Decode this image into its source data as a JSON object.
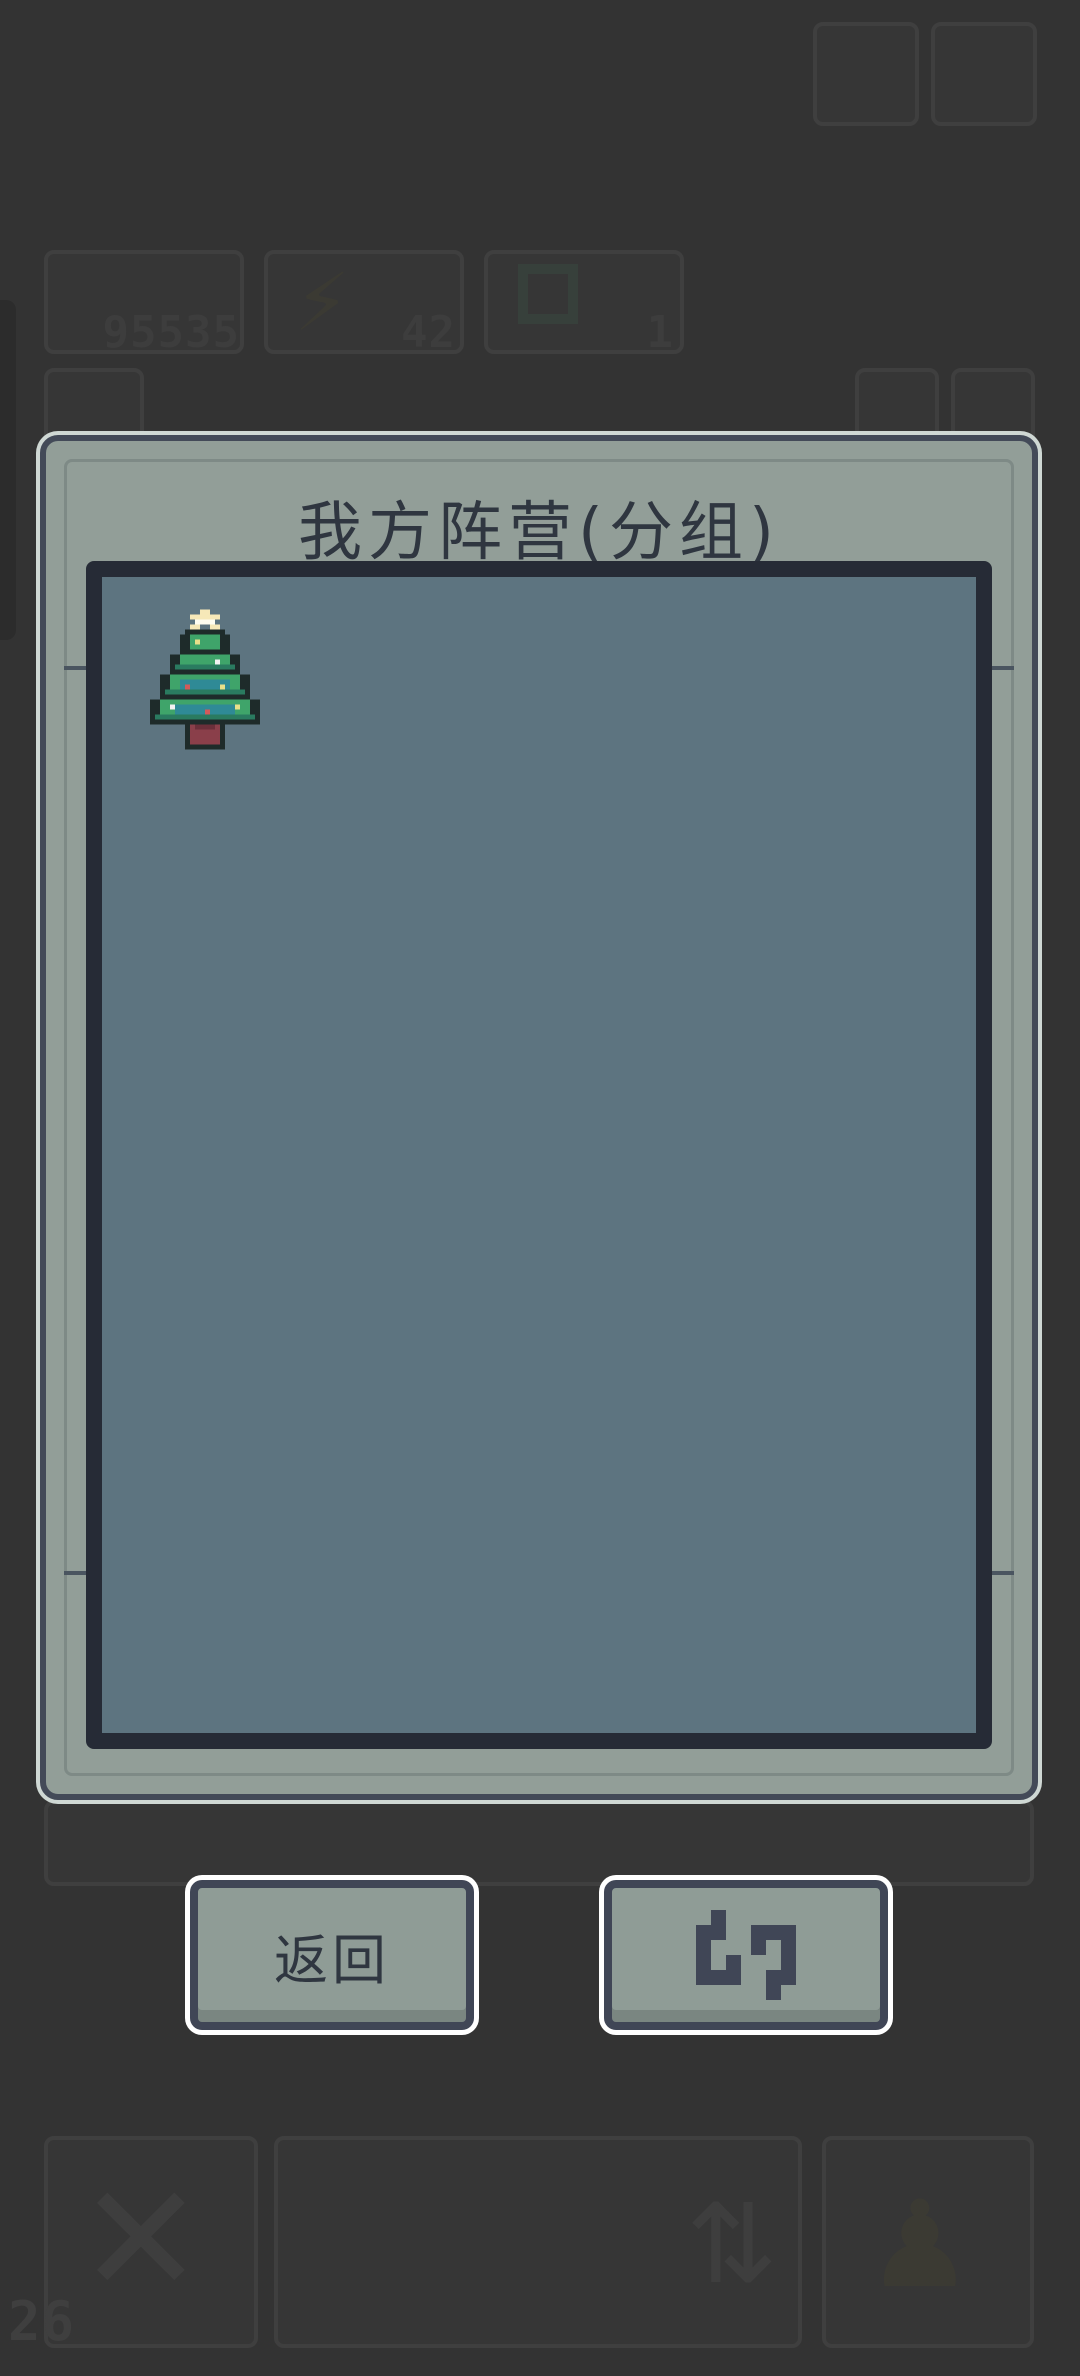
{
  "hud": {
    "gold": "95535",
    "energy": "42",
    "gems": "1",
    "level": "26"
  },
  "dialog": {
    "title": "我方阵营(分组)",
    "units": [
      {
        "name": "christmas-tree"
      }
    ]
  },
  "buttons": {
    "back_label": "返回",
    "refresh_icon": "refresh-icon"
  }
}
